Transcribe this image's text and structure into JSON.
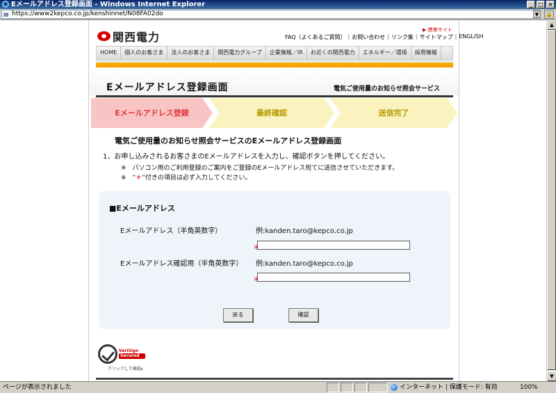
{
  "window": {
    "title": "Eメールアドレス登録画面 - Windows Internet Explorer",
    "url": "https://www2kepco.co.jp/kenshinnet/N08FA02do"
  },
  "header": {
    "logo_text": "関西電力",
    "mobile_link": "▶ 携帯サイト",
    "utility_links": [
      "FAQ（よくあるご質問）",
      "お問い合わせ",
      "リンク集",
      "サイトマップ",
      "ENGLISH"
    ]
  },
  "nav": {
    "items": [
      "HOME",
      "個人のお客さま",
      "法人のお客さま",
      "関西電力グループ",
      "企業情報／IR",
      "お近くの関西電力",
      "エネルギー／環境",
      "採用情報"
    ]
  },
  "page": {
    "title": "Eメールアドレス登録画面",
    "service_name": "電気ご使用量のお知らせ照会サービス"
  },
  "steps": [
    {
      "label": "Eメールアドレス登録",
      "active": true
    },
    {
      "label": "最終確認",
      "active": false
    },
    {
      "label": "送信完了",
      "active": false
    }
  ],
  "content": {
    "lead": "電気ご使用量のお知らせ照会サービスのEメールアドレス登録画面",
    "instruction": "1．お申し込みされるお客さまのEメールアドレスを入力し、確認ボタンを押してください。",
    "note1": "※　パソコン用のご利用登録のご案内をご登録のEメールアドレス宛てに送信させていただきます。",
    "note2_prefix": "※　”",
    "note2_star": "＊",
    "note2_suffix": "”付きの項目は必ず入力してください。"
  },
  "form": {
    "section_title": "■Eメールアドレス",
    "required_mark": "＊",
    "email": {
      "label": "Eメールアドレス（半角英数字）",
      "example": "例:kanden.taro@kepco.co.jp",
      "value": ""
    },
    "email_confirm": {
      "label": "Eメールアドレス確認用（半角英数字）",
      "example": "例:kanden.taro@kepco.co.jp",
      "value": ""
    },
    "back_label": "戻る",
    "confirm_label": "確認"
  },
  "verisign": {
    "brand_top": "VeriSign",
    "brand_bottom": "Secured",
    "caption": "クリックして検証▸"
  },
  "statusbar": {
    "message": "ページが表示されました",
    "zone": "インターネット | 保護モード: 有効",
    "zoom": "100%"
  }
}
